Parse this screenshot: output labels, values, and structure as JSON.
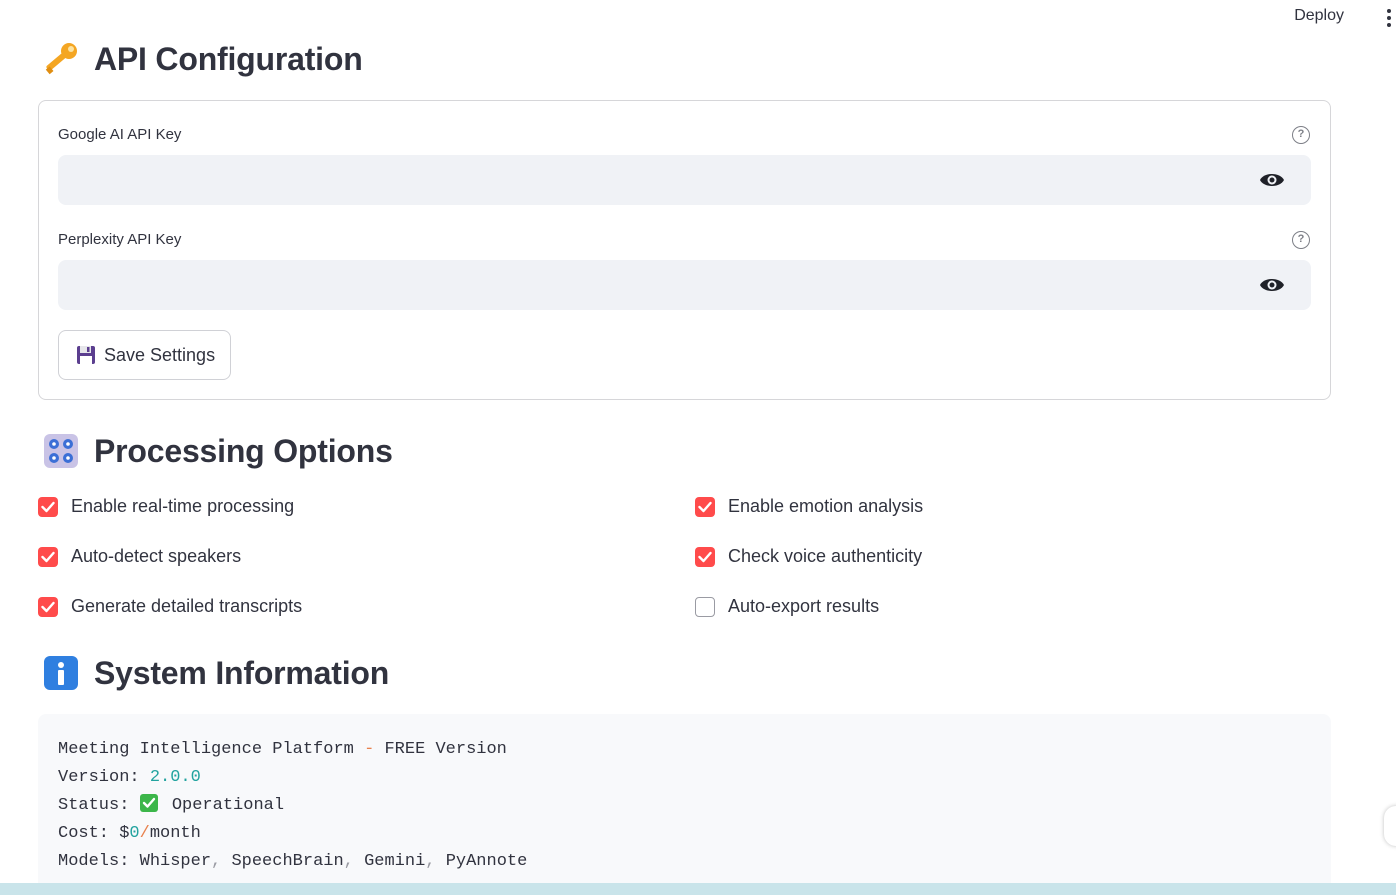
{
  "toolbar": {
    "deploy_label": "Deploy"
  },
  "api_section": {
    "title": "API Configuration",
    "icon": "key-icon",
    "fields": [
      {
        "label": "Google AI API Key",
        "value": "",
        "help_icon": "question-circle-icon",
        "toggle_icon": "eye-icon"
      },
      {
        "label": "Perplexity API Key",
        "value": "",
        "help_icon": "question-circle-icon",
        "toggle_icon": "eye-icon"
      }
    ],
    "save_button": {
      "label": "Save Settings",
      "icon": "floppy-disk-icon"
    }
  },
  "processing_section": {
    "title": "Processing Options",
    "icon": "control-knobs-icon",
    "options": [
      {
        "label": "Enable real-time processing",
        "checked": true
      },
      {
        "label": "Auto-detect speakers",
        "checked": true
      },
      {
        "label": "Generate detailed transcripts",
        "checked": true
      },
      {
        "label": "Enable emotion analysis",
        "checked": true
      },
      {
        "label": "Check voice authenticity",
        "checked": true
      },
      {
        "label": "Auto-export results",
        "checked": false
      }
    ]
  },
  "system_section": {
    "title": "System Information",
    "icon": "info-icon",
    "lines": {
      "line1_a": "Meeting Intelligence Platform",
      "line1_sep": "-",
      "line1_b": "FREE Version",
      "line2_key": "Version:",
      "line2_val": "2.0.0",
      "line3_key": "Status:",
      "line3_val": "Operational",
      "line4_key": "Cost:",
      "line4_currency": "$",
      "line4_amount": "0",
      "line4_sep": "/",
      "line4_unit": "month",
      "line5_key": "Models:",
      "line5_models": [
        "Whisper",
        "SpeechBrain",
        "Gemini",
        "PyAnnote"
      ]
    }
  },
  "colors": {
    "accent": "#ff4b4b",
    "text": "#31333f",
    "input_bg": "#f0f2f6",
    "code_num": "#22a39f",
    "code_op": "#e8814d"
  }
}
